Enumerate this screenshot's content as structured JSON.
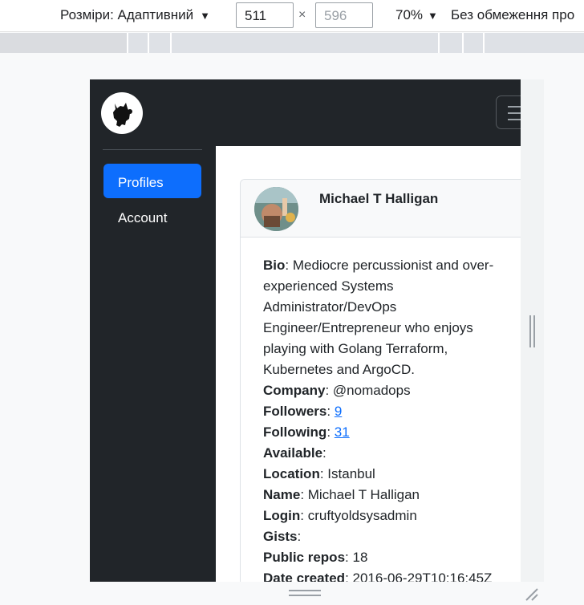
{
  "devtools": {
    "dimensions_label": "Розміри: Адаптивний",
    "width_value": "511",
    "height_placeholder": "596",
    "times": "×",
    "zoom": "70%",
    "throttle": "Без обмеження про"
  },
  "nav": {
    "items": [
      {
        "label": "Profiles",
        "active": true
      },
      {
        "label": "Account",
        "active": false
      }
    ]
  },
  "profile": {
    "name": "Michael T Halligan",
    "bio_label": "Bio",
    "bio_text": "Mediocre percussionist and over-experienced Systems Administrator/DevOps Engineer/Entrepreneur who enjoys playing with Golang Terraform, Kubernetes and ArgoCD.",
    "fields": [
      {
        "label": "Company",
        "value": "@nomadops",
        "link": false
      },
      {
        "label": "Followers",
        "value": "9",
        "link": true
      },
      {
        "label": "Following",
        "value": "31",
        "link": true
      },
      {
        "label": "Available",
        "value": "",
        "link": false
      },
      {
        "label": "Location",
        "value": "Istanbul",
        "link": false
      },
      {
        "label": "Name",
        "value": "Michael T Halligan",
        "link": false
      },
      {
        "label": "Login",
        "value": "cruftyoldsysadmin",
        "link": false
      },
      {
        "label": "Gists",
        "value": "",
        "link": false
      },
      {
        "label": "Public repos",
        "value": "18",
        "link": false
      },
      {
        "label": "Date created",
        "value": "2016-06-29T10:16:45Z",
        "link": false
      }
    ]
  },
  "colors": {
    "accent": "#0d6efd",
    "navbar": "#212529"
  }
}
